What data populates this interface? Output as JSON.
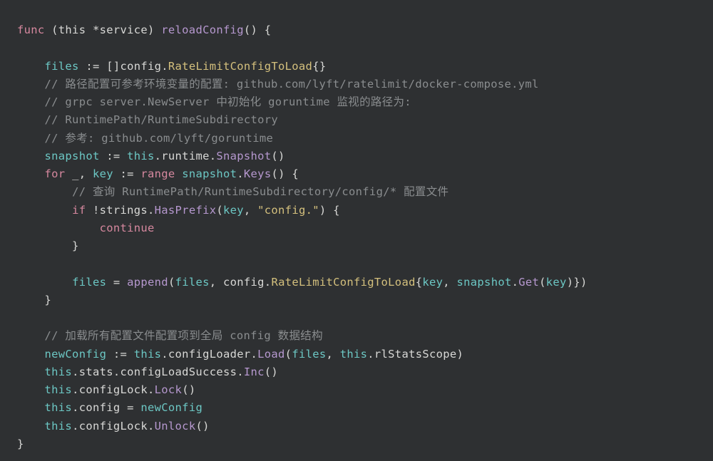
{
  "code": {
    "l1": [
      [
        "kw",
        "func"
      ],
      [
        "plain",
        " (this *service) "
      ],
      [
        "fn",
        "reloadConfig"
      ],
      [
        "plain",
        "() {"
      ]
    ],
    "l2": [
      [
        "plain",
        ""
      ]
    ],
    "l3": [
      [
        "plain",
        "    "
      ],
      [
        "teal",
        "files"
      ],
      [
        "plain",
        " := []config."
      ],
      [
        "type",
        "RateLimitConfigToLoad"
      ],
      [
        "plain",
        "{}"
      ]
    ],
    "l4": [
      [
        "plain",
        "    "
      ],
      [
        "comment",
        "// 路径配置可参考环境变量的配置: github.com/lyft/ratelimit/docker-compose.yml"
      ]
    ],
    "l5": [
      [
        "plain",
        "    "
      ],
      [
        "comment",
        "// grpc server.NewServer 中初始化 goruntime 监视的路径为:"
      ]
    ],
    "l6": [
      [
        "plain",
        "    "
      ],
      [
        "comment",
        "// RuntimePath/RuntimeSubdirectory"
      ]
    ],
    "l7": [
      [
        "plain",
        "    "
      ],
      [
        "comment",
        "// 参考: github.com/lyft/goruntime"
      ]
    ],
    "l8": [
      [
        "plain",
        "    "
      ],
      [
        "teal",
        "snapshot"
      ],
      [
        "plain",
        " := "
      ],
      [
        "teal",
        "this"
      ],
      [
        "plain",
        ".runtime."
      ],
      [
        "fn",
        "Snapshot"
      ],
      [
        "plain",
        "()"
      ]
    ],
    "l9": [
      [
        "plain",
        "    "
      ],
      [
        "kw",
        "for"
      ],
      [
        "plain",
        " _, "
      ],
      [
        "teal",
        "key"
      ],
      [
        "plain",
        " := "
      ],
      [
        "kw",
        "range"
      ],
      [
        "plain",
        " "
      ],
      [
        "teal",
        "snapshot"
      ],
      [
        "plain",
        "."
      ],
      [
        "fn",
        "Keys"
      ],
      [
        "plain",
        "() {"
      ]
    ],
    "l10": [
      [
        "plain",
        "        "
      ],
      [
        "comment",
        "// 查询 RuntimePath/RuntimeSubdirectory/config/* 配置文件"
      ]
    ],
    "l11": [
      [
        "plain",
        "        "
      ],
      [
        "kw",
        "if"
      ],
      [
        "plain",
        " !strings."
      ],
      [
        "fn",
        "HasPrefix"
      ],
      [
        "plain",
        "("
      ],
      [
        "teal",
        "key"
      ],
      [
        "plain",
        ", "
      ],
      [
        "str",
        "\"config.\""
      ],
      [
        "plain",
        ") {"
      ]
    ],
    "l12": [
      [
        "plain",
        "            "
      ],
      [
        "kw",
        "continue"
      ]
    ],
    "l13": [
      [
        "plain",
        "        }"
      ]
    ],
    "l14": [
      [
        "plain",
        ""
      ]
    ],
    "l15": [
      [
        "plain",
        "        "
      ],
      [
        "teal",
        "files"
      ],
      [
        "plain",
        " = "
      ],
      [
        "fn",
        "append"
      ],
      [
        "plain",
        "("
      ],
      [
        "teal",
        "files"
      ],
      [
        "plain",
        ", config."
      ],
      [
        "type",
        "RateLimitConfigToLoad"
      ],
      [
        "plain",
        "{"
      ],
      [
        "teal",
        "key"
      ],
      [
        "plain",
        ", "
      ],
      [
        "teal",
        "snapshot"
      ],
      [
        "plain",
        "."
      ],
      [
        "fn",
        "Get"
      ],
      [
        "plain",
        "("
      ],
      [
        "teal",
        "key"
      ],
      [
        "plain",
        ")})"
      ]
    ],
    "l16": [
      [
        "plain",
        "    }"
      ]
    ],
    "l17": [
      [
        "plain",
        ""
      ]
    ],
    "l18": [
      [
        "plain",
        "    "
      ],
      [
        "comment",
        "// 加载所有配置文件配置项到全局 config 数据结构"
      ]
    ],
    "l19": [
      [
        "plain",
        "    "
      ],
      [
        "teal",
        "newConfig"
      ],
      [
        "plain",
        " := "
      ],
      [
        "teal",
        "this"
      ],
      [
        "plain",
        ".configLoader."
      ],
      [
        "fn",
        "Load"
      ],
      [
        "plain",
        "("
      ],
      [
        "teal",
        "files"
      ],
      [
        "plain",
        ", "
      ],
      [
        "teal",
        "this"
      ],
      [
        "plain",
        ".rlStatsScope)"
      ]
    ],
    "l20": [
      [
        "plain",
        "    "
      ],
      [
        "teal",
        "this"
      ],
      [
        "plain",
        ".stats.configLoadSuccess."
      ],
      [
        "fn",
        "Inc"
      ],
      [
        "plain",
        "()"
      ]
    ],
    "l21": [
      [
        "plain",
        "    "
      ],
      [
        "teal",
        "this"
      ],
      [
        "plain",
        ".configLock."
      ],
      [
        "fn",
        "Lock"
      ],
      [
        "plain",
        "()"
      ]
    ],
    "l22": [
      [
        "plain",
        "    "
      ],
      [
        "teal",
        "this"
      ],
      [
        "plain",
        ".config = "
      ],
      [
        "teal",
        "newConfig"
      ]
    ],
    "l23": [
      [
        "plain",
        "    "
      ],
      [
        "teal",
        "this"
      ],
      [
        "plain",
        ".configLock."
      ],
      [
        "fn",
        "Unlock"
      ],
      [
        "plain",
        "()"
      ]
    ],
    "l24": [
      [
        "plain",
        "}"
      ]
    ]
  },
  "line_order": [
    "l1",
    "l2",
    "l3",
    "l4",
    "l5",
    "l6",
    "l7",
    "l8",
    "l9",
    "l10",
    "l11",
    "l12",
    "l13",
    "l14",
    "l15",
    "l16",
    "l17",
    "l18",
    "l19",
    "l20",
    "l21",
    "l22",
    "l23",
    "l24"
  ]
}
